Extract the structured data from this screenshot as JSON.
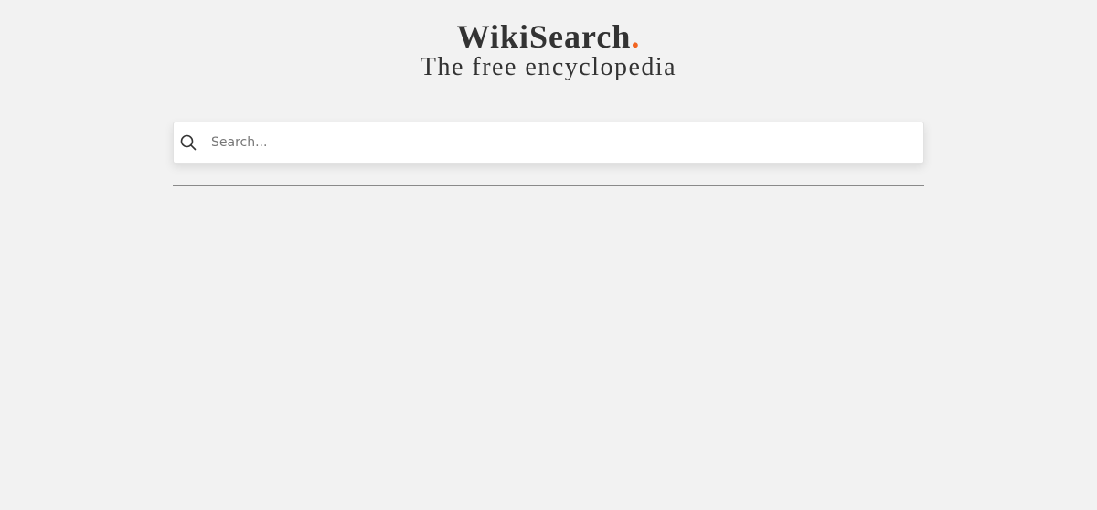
{
  "brand": {
    "title": "WikiSearch",
    "dot": ".",
    "subtitle": "The free encyclopedia",
    "accent_color": "#f26522"
  },
  "search": {
    "icon": "search-icon",
    "placeholder": "Search...",
    "value": ""
  }
}
